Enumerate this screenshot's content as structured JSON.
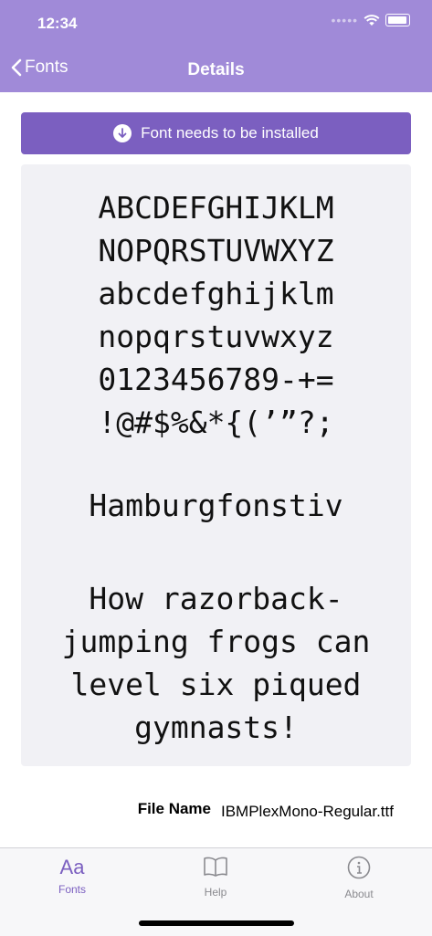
{
  "status": {
    "time": "12:34",
    "dots": "•••••"
  },
  "nav": {
    "back_label": "Fonts",
    "title": "Details"
  },
  "install": {
    "label": "Font needs to be installed"
  },
  "preview": {
    "glyph_lines": [
      "ABCDEFGHIJKLM",
      "NOPQRSTUVWXYZ",
      "abcdefghijklm",
      "nopqrstuvwxyz",
      "0123456789-+=",
      "!@#$%&*{(’”?;"
    ],
    "sample_word": "Hamburgfonstiv",
    "pangram_lines": [
      "How razorback-",
      "jumping frogs can",
      "level six piqued",
      "gymnasts!"
    ]
  },
  "info": {
    "file_name_label": "File Name",
    "file_name_value": "IBMPlexMono-Regular.ttf"
  },
  "tabs": [
    {
      "label": "Fonts",
      "icon": "Aa"
    },
    {
      "label": "Help",
      "icon": "book-icon"
    },
    {
      "label": "About",
      "icon": "info-icon"
    }
  ],
  "colors": {
    "header": "#a08ad8",
    "accent": "#7b5fc0",
    "preview_bg": "#f1f1f5"
  }
}
